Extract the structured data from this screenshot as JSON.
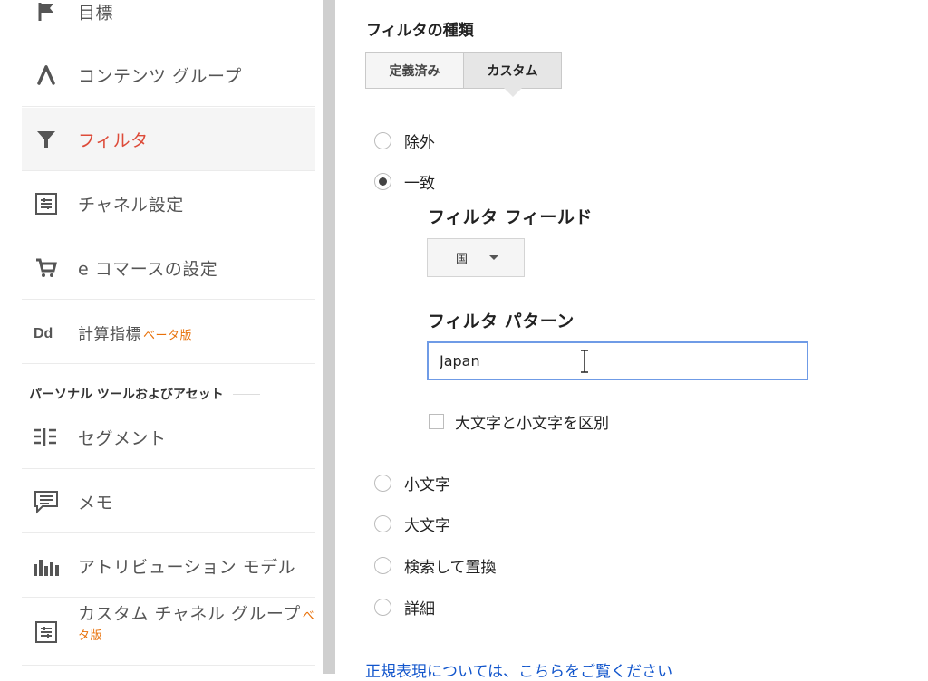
{
  "sidebar": {
    "items": [
      {
        "label": "目標",
        "icon": "flag-icon"
      },
      {
        "label": "コンテンツ グループ",
        "icon": "content-group-icon"
      },
      {
        "label": "フィルタ",
        "icon": "filter-icon",
        "active": true
      },
      {
        "label": "チャネル設定",
        "icon": "channel-settings-icon"
      },
      {
        "label": "e コマースの設定",
        "icon": "cart-icon"
      },
      {
        "label": "計算指標",
        "beta": "ベータ版",
        "icon": "calculated-metrics-icon"
      }
    ],
    "section_header": "パーソナル ツールおよびアセット",
    "personal_items": [
      {
        "label": "セグメント",
        "icon": "segments-icon"
      },
      {
        "label": "メモ",
        "icon": "annotation-icon"
      },
      {
        "label": "アトリビューション モデル",
        "icon": "attribution-icon"
      },
      {
        "label": "カスタム チャネル グループ",
        "beta_a": "べ",
        "beta_b": "タ版",
        "icon": "custom-channel-icon"
      }
    ]
  },
  "main": {
    "filter_type_title": "フィルタの種類",
    "tabs": {
      "predefined": "定義済み",
      "custom": "カスタム"
    },
    "options": {
      "exclude": "除外",
      "include": "一致",
      "lowercase": "小文字",
      "uppercase": "大文字",
      "search_replace": "検索して置換",
      "advanced": "詳細"
    },
    "filter_field_title": "フィルタ フィールド",
    "filter_field_value": "国",
    "filter_pattern_title": "フィルタ パターン",
    "filter_pattern_value": "Japan",
    "case_sensitive_label": "大文字と小文字を区別",
    "regex_help_link": "正規表現については、こちらをご覧ください"
  },
  "colors": {
    "active_nav": "#dd4b39",
    "beta": "#e8710a",
    "link": "#1155cc",
    "input_focus": "#6f9be6"
  }
}
